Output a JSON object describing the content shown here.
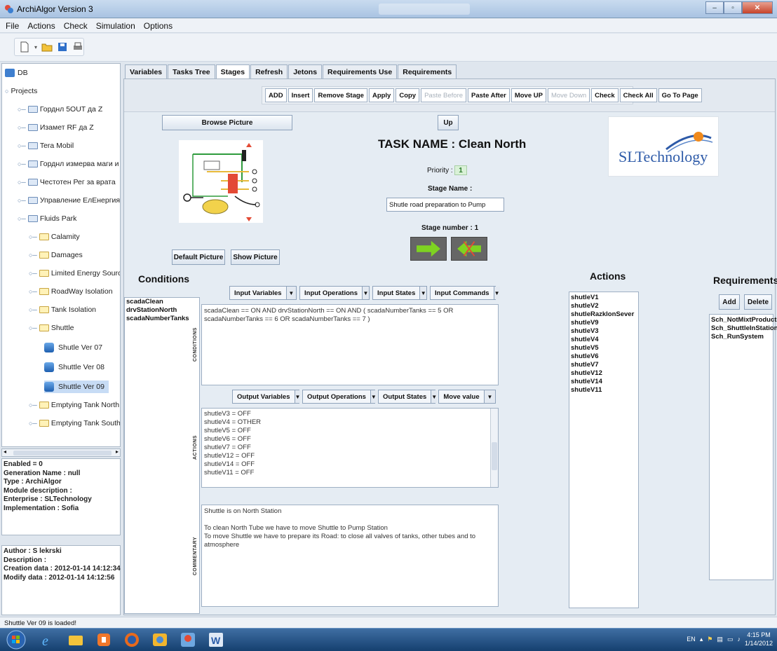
{
  "window": {
    "title": "ArchiAlgor Version 3"
  },
  "menu": [
    "File",
    "Actions",
    "Check",
    "Simulation",
    "Options"
  ],
  "tree": {
    "root": "DB",
    "projects_label": "Projects",
    "items": [
      {
        "label": "Горднл 5OUT да Z"
      },
      {
        "label": "Изамет RF да Z"
      },
      {
        "label": "Tera Mobil"
      },
      {
        "label": "Горднл измерва маги и скорос"
      },
      {
        "label": "Честотен Рег за врата"
      },
      {
        "label": "Управление ЕлЕнергия автомс"
      },
      {
        "label": "Fluids Park"
      },
      {
        "label": "Calamity"
      },
      {
        "label": "Damages"
      },
      {
        "label": "Limited Energy Sources"
      },
      {
        "label": "RoadWay Isolation"
      },
      {
        "label": "Tank Isolation"
      },
      {
        "label": "Shuttle"
      },
      {
        "label": "Shutle Ver 07"
      },
      {
        "label": "Shuttle Ver 08"
      },
      {
        "label": "Shuttle Ver 09"
      },
      {
        "label": "Emptying Tank North"
      },
      {
        "label": "Emptying Tank South"
      }
    ]
  },
  "info": [
    "Enabled = 0",
    "Generation Name : null",
    "Type : ArchiAlgor",
    "Module description :",
    "Enterprise : SLTechnology",
    "Implementation : Sofia"
  ],
  "meta": [
    "Author : S lekrski",
    "Description :",
    "Creation data : 2012-01-14 14:12:34",
    "Modify data : 2012-01-14 14:12:56"
  ],
  "tabs": [
    "Variables",
    "Tasks Tree",
    "Stages",
    "Refresh",
    "Jetons",
    "Requirements Use",
    "Requirements"
  ],
  "active_tab": "Stages",
  "stage_toolbar": {
    "add": "ADD",
    "insert": "Insert",
    "remove": "Remove Stage",
    "apply": "Apply",
    "copy": "Copy",
    "paste_before": "Paste Before",
    "paste_after": "Paste After",
    "move_up": "Move UP",
    "move_down": "Move Down",
    "check": "Check",
    "check_all": "Check All",
    "go_to_page": "Go To Page"
  },
  "stage": {
    "browse_picture": "Browse Picture",
    "up": "Up",
    "task_title": "TASK NAME : Clean North",
    "priority_label": "Priority :",
    "priority_value": "1",
    "stage_name_label": "Stage Name :",
    "stage_name_value": "Shutle road preparation to Pump",
    "stage_number_label": "Stage number : 1",
    "default_picture": "Default Picture",
    "show_picture": "Show Picture"
  },
  "logo_text": "SLTechnology",
  "conditions": {
    "title": "Conditions",
    "variables": [
      "scadaClean",
      "drvStationNorth",
      "scadaNumberTanks"
    ],
    "combos": [
      "Input Variables",
      "Input Operations",
      "Input States",
      "Input Commands"
    ],
    "text": "scadaClean == ON AND drvStationNorth == ON AND ( scadaNumberTanks == 5 OR scadaNumberTanks == 6 OR scadaNumberTanks == 7 )",
    "side_label": "CONDITIONS"
  },
  "actions_area": {
    "combos": [
      "Output Variables",
      "Output Operations",
      "Output States",
      "Move value"
    ],
    "lines": [
      "shutleV3 = OFF",
      "shutleV4 = OTHER",
      "shutleV5 = OFF",
      "shutleV6 = OFF",
      "shutleV7 = OFF",
      "shutleV12 = OFF",
      "shutleV14 = OFF",
      "shutleV11 = OFF"
    ],
    "side_label": "ACTIONS"
  },
  "comments": {
    "lines": [
      "Shuttle is on North Station",
      "",
      "To clean North Tube we have to move Shuttle to Pump Station",
      "To move Shuttle we have to prepare its Road: to close all valves of tanks, other tubes and to atmosphere"
    ],
    "side_label": "COMMENTARY"
  },
  "actions_list": {
    "title": "Actions",
    "items": [
      "shutleV1",
      "shutleV2",
      "shutleRazklonSever",
      "shutleV9",
      "shutleV3",
      "shutleV4",
      "shutleV5",
      "shutleV6",
      "shutleV7",
      "shutleV12",
      "shutleV14",
      "shutleV11"
    ]
  },
  "requirements": {
    "title": "Requirements",
    "add": "Add",
    "delete": "Delete",
    "items": [
      "Sch_NotMixtProducts",
      "Sch_ShuttleInStation",
      "Sch_RunSystem"
    ]
  },
  "status": "Shuttle Ver 09 is loaded!",
  "taskbar": {
    "lang": "EN",
    "time": "4:15 PM",
    "date": "1/14/2012"
  },
  "colors": {
    "arrow_green": "#7ed321",
    "accent_blue": "#1e5fb0",
    "logo_blue": "#2d5aa8",
    "logo_orange": "#f08a1c"
  }
}
